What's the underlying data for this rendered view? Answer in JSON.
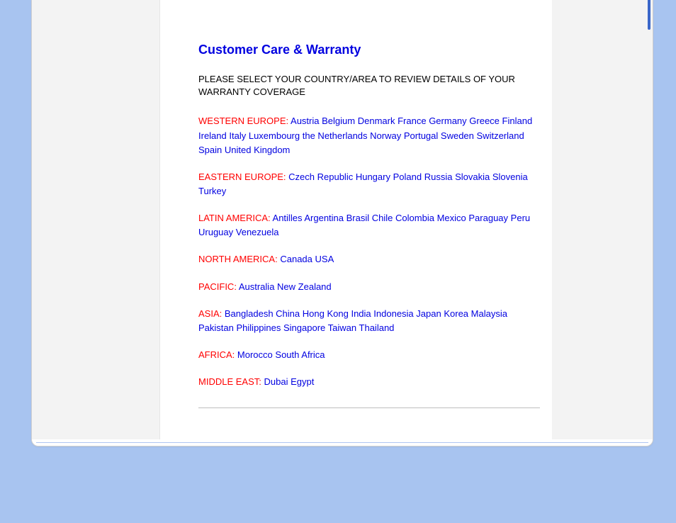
{
  "title": "Customer Care & Warranty",
  "instruction": "PLEASE SELECT YOUR COUNTRY/AREA TO REVIEW DETAILS OF YOUR WARRANTY COVERAGE",
  "regions": [
    {
      "label": "WESTERN EUROPE:",
      "countries": [
        "Austria",
        "Belgium",
        "Denmark",
        "France",
        "Germany",
        "Greece",
        "Finland",
        "Ireland",
        "Italy",
        "Luxembourg",
        "the Netherlands",
        "Norway",
        "Portugal",
        "Sweden",
        "Switzerland",
        "Spain",
        "United Kingdom"
      ]
    },
    {
      "label": "EASTERN EUROPE:",
      "countries": [
        "Czech Republic",
        "Hungary",
        "Poland",
        "Russia",
        "Slovakia",
        "Slovenia",
        "Turkey"
      ]
    },
    {
      "label": "LATIN AMERICA:",
      "countries": [
        "Antilles",
        "Argentina",
        "Brasil",
        "Chile",
        "Colombia",
        "Mexico",
        "Paraguay",
        "Peru",
        "Uruguay",
        "Venezuela"
      ]
    },
    {
      "label": "NORTH AMERICA:",
      "countries": [
        "Canada",
        "USA"
      ]
    },
    {
      "label": "PACIFIC:",
      "countries": [
        "Australia",
        "New Zealand"
      ]
    },
    {
      "label": "ASIA:",
      "countries": [
        "Bangladesh",
        "China",
        "Hong Kong",
        "India",
        "Indonesia",
        "Japan",
        "Korea",
        "Malaysia",
        "Pakistan",
        "Philippines",
        "Singapore",
        "Taiwan",
        "Thailand"
      ]
    },
    {
      "label": "AFRICA:",
      "countries": [
        "Morocco",
        "South Africa"
      ]
    },
    {
      "label": "MIDDLE EAST:",
      "countries": [
        "Dubai",
        "Egypt"
      ]
    }
  ]
}
